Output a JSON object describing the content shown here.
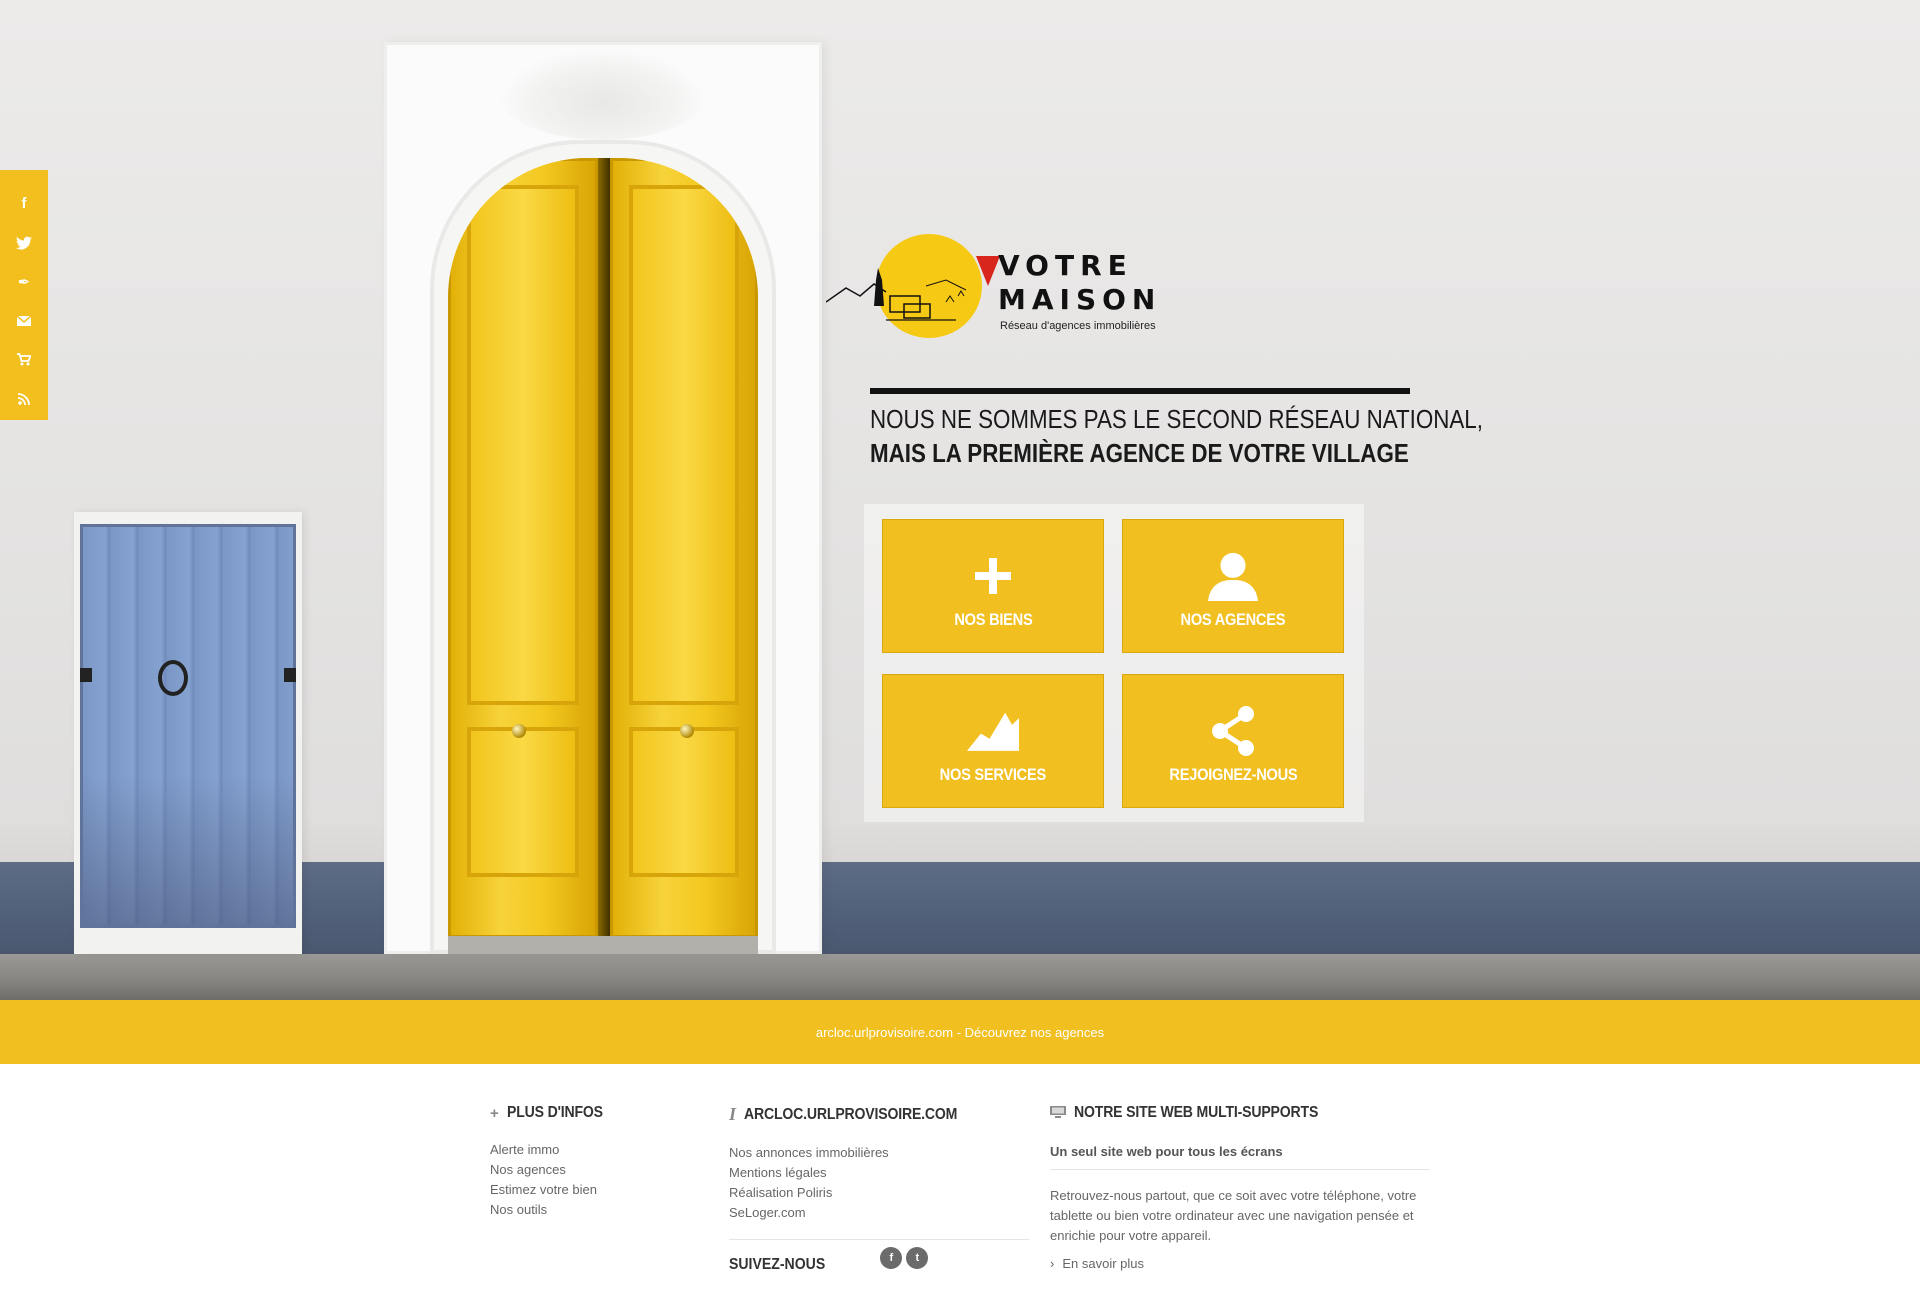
{
  "social": {
    "items": [
      {
        "name": "facebook",
        "glyph": "f"
      },
      {
        "name": "twitter",
        "glyph": "🐦"
      },
      {
        "name": "feather",
        "glyph": "✒"
      },
      {
        "name": "mail",
        "glyph": "✉"
      },
      {
        "name": "cart",
        "glyph": "🛒"
      },
      {
        "name": "rss",
        "glyph": "◔"
      }
    ],
    "color": "#f2bf1e"
  },
  "logo": {
    "line1": "VOTRE",
    "line2": "MAISON",
    "tagline": "Réseau d'agences immobilières",
    "sun_color": "#f6c915",
    "flag_color": "#d9261c"
  },
  "slogan": {
    "line1": "Nous ne sommes pas le second réseau national,",
    "line2": "mais la première agence de votre village"
  },
  "tiles": [
    {
      "label": "NOS BIENS",
      "icon": "plus-icon"
    },
    {
      "label": "NOS AGENCES",
      "icon": "user-icon"
    },
    {
      "label": "NOS SERVICES",
      "icon": "chart-icon"
    },
    {
      "label": "REJOIGNEZ-NOUS",
      "icon": "share-icon"
    }
  ],
  "tile_color": "#f1bf20",
  "band": {
    "site": "arcloc.urlprovisoire.com",
    "separator": " - ",
    "link": "Découvrez nos agences"
  },
  "footer": {
    "infos": {
      "icon": "+",
      "title": "PLUS D'INFOS",
      "links": [
        "Alerte immo",
        "Nos agences",
        "Estimez votre bien",
        "Nos outils"
      ]
    },
    "site": {
      "icon": "i",
      "title": "ARCLOC.URLPROVISOIRE.COM",
      "links": [
        "Nos annonces immobilières",
        "Mentions légales",
        "Réalisation Poliris",
        "SeLoger.com"
      ],
      "follow_title": "SUIVEZ-NOUS",
      "follow_icons": [
        "f",
        "t"
      ]
    },
    "multi": {
      "title": "NOTRE SITE WEB MULTI-SUPPORTS",
      "subtitle": "Un seul site web pour tous les écrans",
      "text": "Retrouvez-nous partout, que ce soit avec votre téléphone, votre tablette ou bien votre ordinateur avec une navigation pensée et enrichie pour votre appareil.",
      "more": "En savoir plus"
    }
  }
}
